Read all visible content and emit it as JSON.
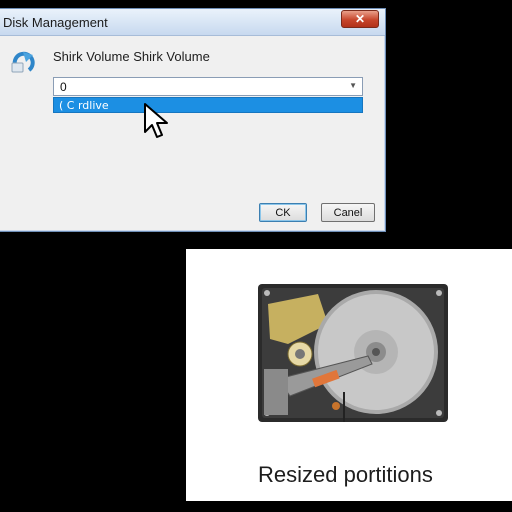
{
  "dialog": {
    "title": "Disk Management",
    "heading": "Shirk Volume Shirk Volume",
    "combo_value": "0",
    "selected_option": "( C rdlive",
    "ok_label": "CK",
    "cancel_label": "Canel",
    "close_symbol": "✕"
  },
  "illustration": {
    "caption": "Resized portitions"
  },
  "colors": {
    "selection": "#1c8fe3",
    "title_gradient_top": "#eaf2fb",
    "close_button": "#c7462c"
  }
}
